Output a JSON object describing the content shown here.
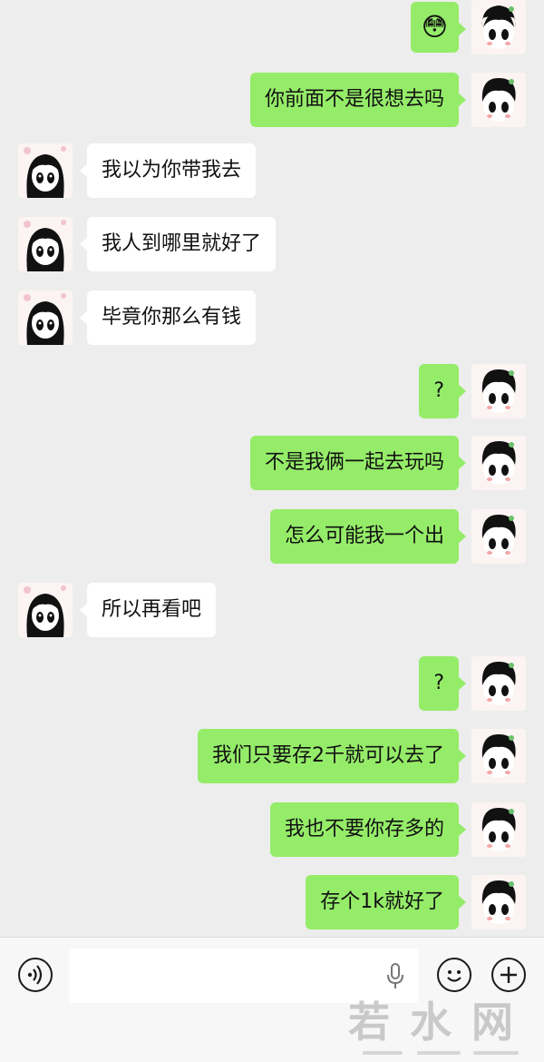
{
  "messages": [
    {
      "side": "me",
      "type": "emoji",
      "emoji": "😳"
    },
    {
      "side": "me",
      "text": "你前面不是很想去吗"
    },
    {
      "side": "them",
      "text": "我以为你带我去"
    },
    {
      "side": "them",
      "text": "我人到哪里就好了"
    },
    {
      "side": "them",
      "text": "毕竟你那么有钱"
    },
    {
      "side": "me",
      "text": "?"
    },
    {
      "side": "me",
      "text": "不是我俩一起去玩吗"
    },
    {
      "side": "me",
      "text": "怎么可能我一个出"
    },
    {
      "side": "them",
      "text": "所以再看吧"
    },
    {
      "side": "me",
      "text": "?"
    },
    {
      "side": "me",
      "text": "我们只要存2千就可以去了"
    },
    {
      "side": "me",
      "text": "我也不要你存多的"
    },
    {
      "side": "me",
      "text": "存个1k就好了"
    }
  ],
  "input": {
    "voice_icon": "voice-icon",
    "mic_icon": "mic-icon",
    "emoji_icon": "emoji-icon",
    "plus_icon": "plus-icon"
  },
  "watermark": "若水网",
  "colors": {
    "background": "#ededed",
    "my_bubble": "#95ec69",
    "their_bubble": "#ffffff",
    "input_bar": "#f7f7f7"
  }
}
